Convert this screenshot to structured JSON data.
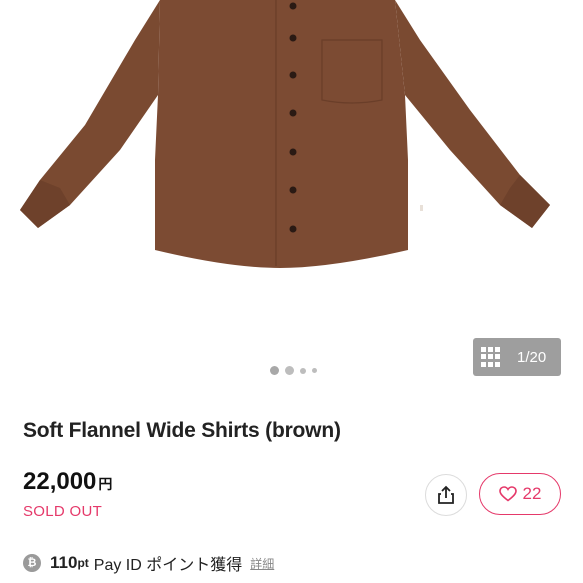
{
  "gallery": {
    "counter": "1/20",
    "dots": 4,
    "active_dot": 1
  },
  "product": {
    "title": "Soft Flannel Wide Shirts (brown)",
    "price": "22,000",
    "currency": "円",
    "status": "SOLD OUT",
    "image_color": "#7a4a31"
  },
  "actions": {
    "like_count": "22",
    "accent_color": "#e5396a"
  },
  "points": {
    "amount": "110",
    "unit": "pt",
    "text": "Pay ID ポイント獲得",
    "detail_link": "詳細"
  },
  "icons": [
    "grid-icon",
    "share-icon",
    "heart-icon",
    "coin-icon"
  ]
}
